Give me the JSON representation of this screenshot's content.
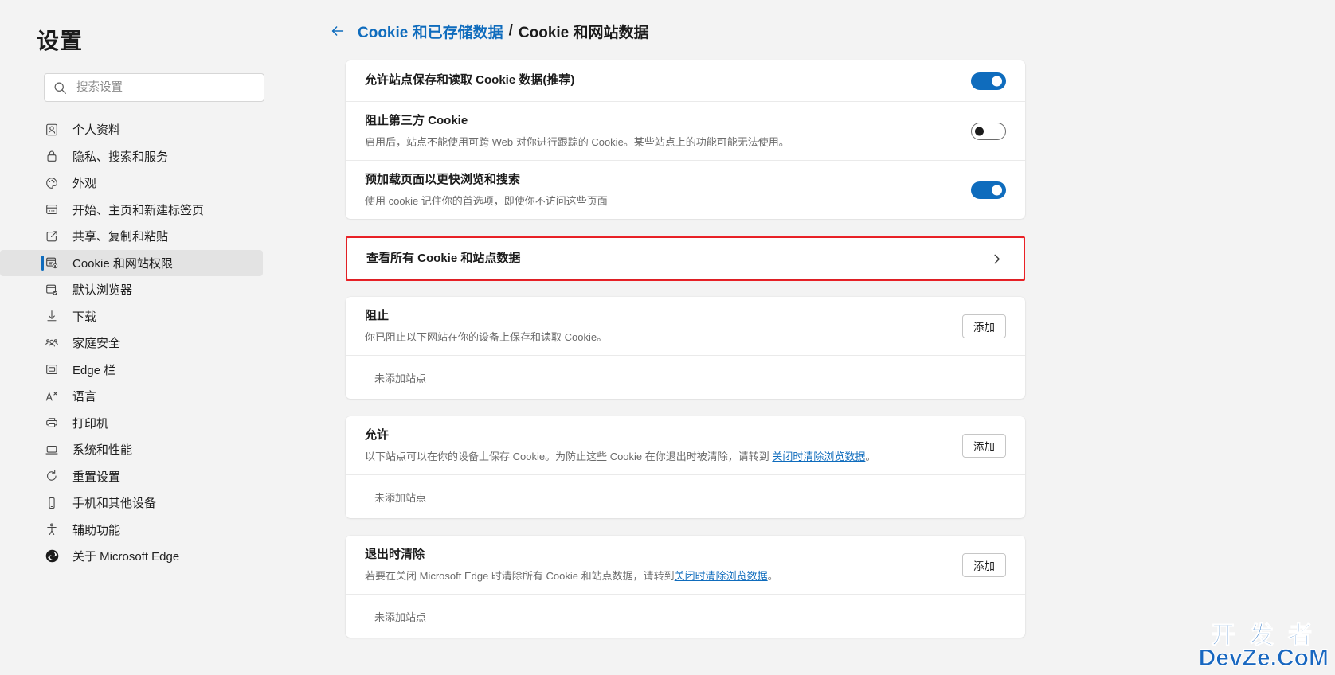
{
  "sidebar": {
    "title": "设置",
    "search": {
      "placeholder": "搜索设置",
      "value": "",
      "icon": "search-icon"
    },
    "items": [
      {
        "label": "个人资料",
        "icon": "profile-icon",
        "selected": false
      },
      {
        "label": "隐私、搜索和服务",
        "icon": "lock-icon",
        "selected": false
      },
      {
        "label": "外观",
        "icon": "palette-icon",
        "selected": false
      },
      {
        "label": "开始、主页和新建标签页",
        "icon": "home-page-icon",
        "selected": false
      },
      {
        "label": "共享、复制和粘贴",
        "icon": "share-icon",
        "selected": false
      },
      {
        "label": "Cookie 和网站权限",
        "icon": "cookie-settings-icon",
        "selected": true
      },
      {
        "label": "默认浏览器",
        "icon": "default-browser-icon",
        "selected": false
      },
      {
        "label": "下载",
        "icon": "download-icon",
        "selected": false
      },
      {
        "label": "家庭安全",
        "icon": "family-icon",
        "selected": false
      },
      {
        "label": "Edge 栏",
        "icon": "edge-bar-icon",
        "selected": false
      },
      {
        "label": "语言",
        "icon": "language-icon",
        "selected": false
      },
      {
        "label": "打印机",
        "icon": "printer-icon",
        "selected": false
      },
      {
        "label": "系统和性能",
        "icon": "system-icon",
        "selected": false
      },
      {
        "label": "重置设置",
        "icon": "reset-icon",
        "selected": false
      },
      {
        "label": "手机和其他设备",
        "icon": "phone-icon",
        "selected": false
      },
      {
        "label": "辅助功能",
        "icon": "accessibility-icon",
        "selected": false
      },
      {
        "label": "关于 Microsoft Edge",
        "icon": "edge-logo-icon",
        "selected": false
      }
    ]
  },
  "breadcrumb": {
    "back_icon": "back-arrow-icon",
    "parent": "Cookie 和已存储数据",
    "separator": "/",
    "current": "Cookie 和网站数据"
  },
  "main": {
    "settings_card": {
      "rows": [
        {
          "title": "允许站点保存和读取 Cookie 数据(推荐)",
          "sub": "",
          "toggle": "on"
        },
        {
          "title": "阻止第三方 Cookie",
          "sub": "启用后，站点不能使用可跨 Web 对你进行跟踪的 Cookie。某些站点上的功能可能无法使用。",
          "toggle": "off"
        },
        {
          "title": "预加载页面以更快浏览和搜索",
          "sub": "使用 cookie 记住你的首选项，即使你不访问这些页面",
          "toggle": "on"
        }
      ]
    },
    "view_all_row": {
      "title": "查看所有 Cookie 和站点数据",
      "chevron_icon": "chevron-right-icon",
      "highlight_color": "#ec2227"
    },
    "sections": [
      {
        "title": "阻止",
        "sub_before": "你已阻止以下网站在你的设备上保存和读取 Cookie。",
        "sub_link": "",
        "sub_after": "",
        "add_label": "添加",
        "empty_text": "未添加站点"
      },
      {
        "title": "允许",
        "sub_before": "以下站点可以在你的设备上保存 Cookie。为防止这些 Cookie 在你退出时被清除，请转到 ",
        "sub_link": "关闭时清除浏览数据",
        "sub_after": "。",
        "add_label": "添加",
        "empty_text": "未添加站点"
      },
      {
        "title": "退出时清除",
        "sub_before": "若要在关闭 Microsoft Edge 时清除所有 Cookie 和站点数据，请转到",
        "sub_link": "关闭时清除浏览数据",
        "sub_after": "。",
        "add_label": "添加",
        "empty_text": "未添加站点"
      }
    ]
  },
  "watermark": {
    "line1": "开 发 者",
    "line2": "DevZe.CoM",
    "color": "#1867c0"
  }
}
